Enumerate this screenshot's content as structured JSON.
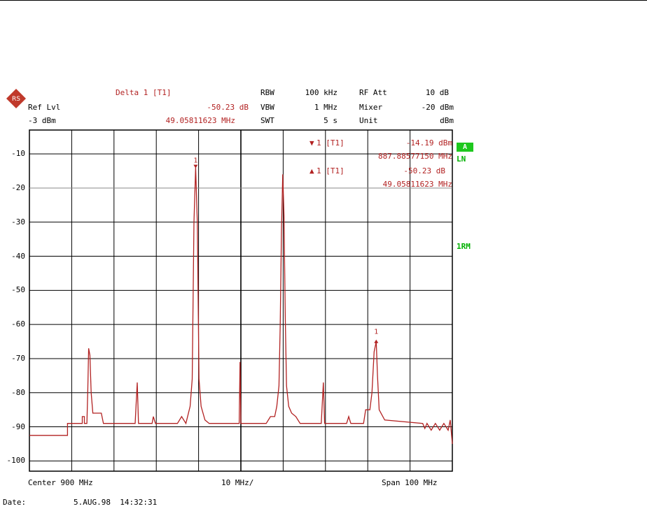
{
  "header": {
    "ref_lvl_label": "Ref Lvl",
    "ref_lvl_value": "-3 dBm",
    "delta_title": "Delta 1 [T1]",
    "delta_db": "-50.23 dB",
    "delta_freq": "49.05811623 MHz",
    "rbw_label": "RBW",
    "rbw_value": "100 kHz",
    "vbw_label": "VBW",
    "vbw_value": "1 MHz",
    "swt_label": "SWT",
    "swt_value": "5 s",
    "rfatt_label": "RF Att",
    "rfatt_value": "10 dB",
    "mixer_label": "Mixer",
    "mixer_value": "-20 dBm",
    "unit_label": "Unit",
    "unit_value": "dBm"
  },
  "markers_info": {
    "m1_label": "1 [T1]",
    "m1_value": "-14.19 dBm",
    "m1_freq": "887.88577150 MHz",
    "d1_label": "1 [T1]",
    "d1_value": "-50.23 dB",
    "d1_freq": "49.05811623 MHz"
  },
  "side_labels": {
    "trace_badge": "A",
    "ln": "LN",
    "rm": "1RM"
  },
  "footer": {
    "center": "Center 900 MHz",
    "div": "10 MHz/",
    "span": "Span 100 MHz",
    "date_label": "Date:",
    "date_value": "5.AUG.98  14:32:31"
  },
  "colors": {
    "trace": "#b22222",
    "grid": "#000000",
    "status": "#1ec81e"
  },
  "chart_data": {
    "type": "line",
    "x_unit": "MHz",
    "y_unit": "dBm",
    "xlim": [
      850,
      950
    ],
    "ylim": [
      -103,
      -3
    ],
    "yticks": [
      -10,
      -20,
      -30,
      -40,
      -50,
      -60,
      -70,
      -80,
      -90,
      -100
    ],
    "ytick_labels": [
      "-10",
      "-20",
      "-30",
      "-40",
      "-50",
      "-60",
      "-70",
      "-80",
      "-90",
      "-100"
    ],
    "reference_line_y": -20,
    "grid": true,
    "series": [
      {
        "points": [
          [
            850,
            -92.5
          ],
          [
            859,
            -92.5
          ],
          [
            859,
            -89
          ],
          [
            862.5,
            -89
          ],
          [
            862.5,
            -87
          ],
          [
            863,
            -87
          ],
          [
            863,
            -89
          ],
          [
            863.6,
            -89
          ],
          [
            863.8,
            -79
          ],
          [
            864,
            -67
          ],
          [
            864.3,
            -69
          ],
          [
            864.6,
            -80
          ],
          [
            865,
            -86
          ],
          [
            867,
            -86
          ],
          [
            867.5,
            -89
          ],
          [
            875,
            -89
          ],
          [
            875.5,
            -77
          ],
          [
            875.8,
            -89
          ],
          [
            879,
            -89
          ],
          [
            879.3,
            -87
          ],
          [
            879.8,
            -89
          ],
          [
            885,
            -89
          ],
          [
            886,
            -87
          ],
          [
            887,
            -89
          ],
          [
            888,
            -84
          ],
          [
            888.5,
            -76
          ],
          [
            888.9,
            -30
          ],
          [
            889.3,
            -14
          ],
          [
            889.7,
            -30
          ],
          [
            890.1,
            -76
          ],
          [
            890.6,
            -84
          ],
          [
            891.5,
            -88
          ],
          [
            892.5,
            -89
          ],
          [
            899.6,
            -89
          ],
          [
            899.8,
            -71
          ],
          [
            900,
            -89
          ],
          [
            906,
            -89
          ],
          [
            907,
            -87
          ],
          [
            908,
            -87
          ],
          [
            908.5,
            -84
          ],
          [
            909,
            -78
          ],
          [
            909.3,
            -60
          ],
          [
            909.6,
            -32
          ],
          [
            909.9,
            -16
          ],
          [
            910.2,
            -28
          ],
          [
            910.5,
            -58
          ],
          [
            910.8,
            -78
          ],
          [
            911.3,
            -84
          ],
          [
            912,
            -86
          ],
          [
            913,
            -87
          ],
          [
            914,
            -89
          ],
          [
            919,
            -89
          ],
          [
            919.5,
            -77
          ],
          [
            919.8,
            -89
          ],
          [
            925,
            -89
          ],
          [
            925.5,
            -87
          ],
          [
            926,
            -89
          ],
          [
            929,
            -89
          ],
          [
            929.5,
            -85
          ],
          [
            930.5,
            -85
          ],
          [
            931,
            -80
          ],
          [
            931.5,
            -68
          ],
          [
            932,
            -65
          ],
          [
            932.3,
            -75
          ],
          [
            932.7,
            -85
          ],
          [
            934,
            -88
          ],
          [
            943,
            -89
          ],
          [
            943.5,
            -90.5
          ],
          [
            944,
            -89
          ],
          [
            945,
            -91
          ],
          [
            946,
            -89
          ],
          [
            947,
            -91
          ],
          [
            948,
            -89
          ],
          [
            949,
            -91
          ],
          [
            949.5,
            -88
          ],
          [
            950,
            -95
          ]
        ]
      }
    ],
    "markers": [
      {
        "label": "1",
        "x": 889.3,
        "y": -14.19,
        "shape": "down"
      },
      {
        "label": "1",
        "x": 932.0,
        "y": -64.42,
        "shape": "up"
      }
    ]
  }
}
